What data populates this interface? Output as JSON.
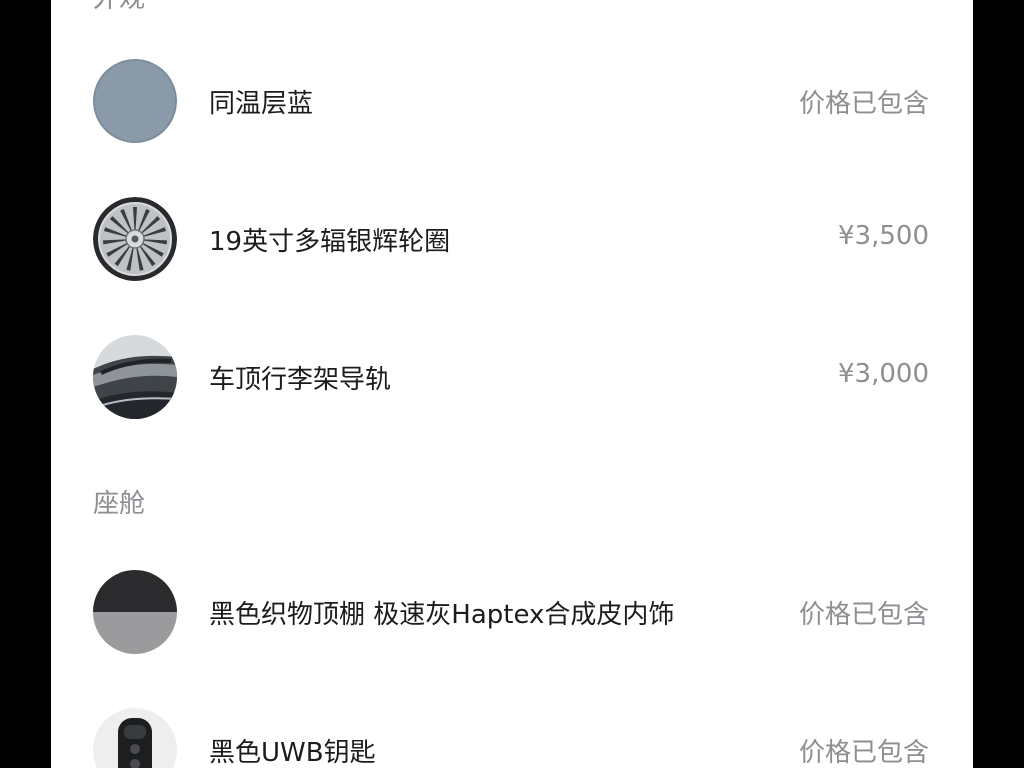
{
  "sections": [
    {
      "title": "外观",
      "items": [
        {
          "name": "同温层蓝",
          "price": "价格已包含",
          "thumb_icon": "paint-swatch-stratosphere-blue",
          "swatch_color": "#8a9aa8"
        },
        {
          "name": "19英寸多辐银辉轮圈",
          "price": "¥3,500",
          "thumb_icon": "wheel-rim"
        },
        {
          "name": "车顶行李架导轨",
          "price": "¥3,000",
          "thumb_icon": "roof-rail"
        }
      ]
    },
    {
      "title": "座舱",
      "items": [
        {
          "name": "黑色织物顶棚 极速灰Haptex合成皮内饰",
          "price": "价格已包含",
          "thumb_icon": "interior-swatch",
          "colors": [
            "#2b2b2d",
            "#9b9b9d"
          ]
        },
        {
          "name": "黑色UWB钥匙",
          "price": "价格已包含",
          "thumb_icon": "car-key"
        }
      ]
    }
  ]
}
